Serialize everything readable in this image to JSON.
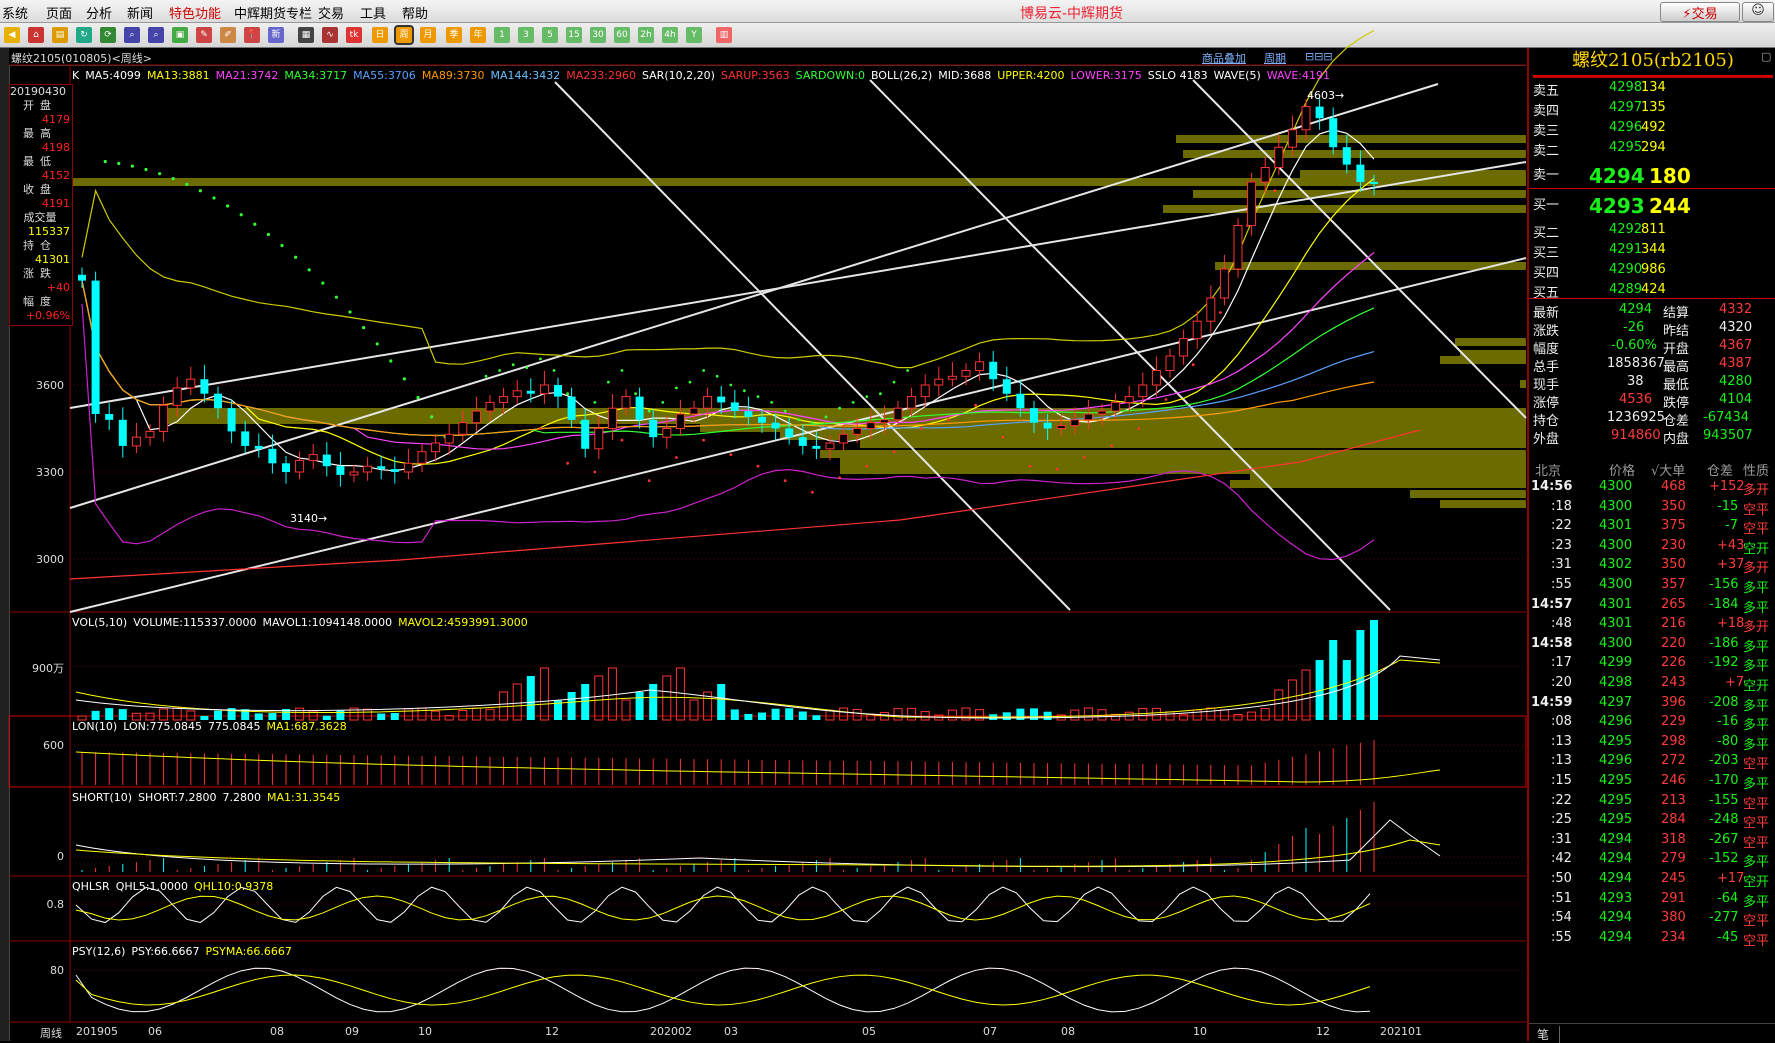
{
  "menu": [
    "系统",
    "页面",
    "分析",
    "新闻",
    "特色功能",
    "中辉期货专栏",
    "交易",
    "工具",
    "帮助"
  ],
  "app_title": "博易云-中辉期货",
  "trade_button": "交易",
  "chart_header": {
    "symbol": "螺纹2105(010805)<周线>",
    "links": [
      "商品叠加",
      "周期"
    ]
  },
  "indicators_main": [
    {
      "text": "K",
      "color": "#ffffff"
    },
    {
      "text": "MA5:4099",
      "color": "#ffffff"
    },
    {
      "text": "MA13:3881",
      "color": "#ffff00"
    },
    {
      "text": "MA21:3742",
      "color": "#ff44ff"
    },
    {
      "text": "MA34:3717",
      "color": "#33ff33"
    },
    {
      "text": "MA55:3706",
      "color": "#5aa0ff"
    },
    {
      "text": "MA89:3730",
      "color": "#ff9900"
    },
    {
      "text": "MA144:3432",
      "color": "#66c0ff"
    },
    {
      "text": "MA233:2960",
      "color": "#ff3333"
    },
    {
      "text": "SAR(10,2,20)",
      "color": "#ffffff"
    },
    {
      "text": "SARUP:3563",
      "color": "#ff3333"
    },
    {
      "text": "SARDOWN:0",
      "color": "#33ff33"
    },
    {
      "text": "BOLL(26,2)",
      "color": "#ffffff"
    },
    {
      "text": "MID:3688",
      "color": "#ffffff"
    },
    {
      "text": "UPPER:4200",
      "color": "#ffff00"
    },
    {
      "text": "LOWER:3175",
      "color": "#ff44ff"
    },
    {
      "text": "SSLO 4183",
      "color": "#ffffff"
    },
    {
      "text": "WAVE(5)",
      "color": "#ffffff"
    },
    {
      "text": "WAVE:4191",
      "color": "#ff44ff"
    }
  ],
  "info_box": [
    {
      "label": "",
      "value": "20190430"
    },
    {
      "label": "开盘",
      "value": "4179"
    },
    {
      "label": "最高",
      "value": "4198"
    },
    {
      "label": "最低",
      "value": "4152"
    },
    {
      "label": "收盘",
      "value": "4191"
    },
    {
      "label": "成交量",
      "value": "115337"
    },
    {
      "label": "持仓",
      "value": "41301"
    },
    {
      "label": "涨跌",
      "value": "+40"
    },
    {
      "label": "幅度",
      "value": "+0.96%"
    }
  ],
  "price_annotations": {
    "high": "4603→",
    "low": "3140→"
  },
  "price_axis": [
    "3600",
    "3300",
    "3000"
  ],
  "vol_indicator": [
    {
      "text": "VOL(5,10)",
      "color": "#ffffff"
    },
    {
      "text": "VOLUME:115337.0000",
      "color": "#ffffff"
    },
    {
      "text": "MAVOL1:1094148.0000",
      "color": "#ffffff"
    },
    {
      "text": "MAVOL2:4593991.3000",
      "color": "#ffff00"
    }
  ],
  "vol_axis": "900万",
  "lon_indicator": [
    {
      "text": "LON(10)",
      "color": "#ffffff"
    },
    {
      "text": "LON:775.0845",
      "color": "#ffffff"
    },
    {
      "text": "775.0845",
      "color": "#ffffff"
    },
    {
      "text": "MA1:687.3628",
      "color": "#ffff00"
    }
  ],
  "lon_axis": "600",
  "short_indicator": [
    {
      "text": "SHORT(10)",
      "color": "#ffffff"
    },
    {
      "text": "SHORT:7.2800",
      "color": "#ffffff"
    },
    {
      "text": "7.2800",
      "color": "#ffffff"
    },
    {
      "text": "MA1:31.3545",
      "color": "#ffff00"
    }
  ],
  "short_axis": "0",
  "qhl_indicator": [
    {
      "text": "QHLSR",
      "color": "#ffffff"
    },
    {
      "text": "QHL5:1.0000",
      "color": "#ffffff"
    },
    {
      "text": "QHL10:0.9378",
      "color": "#ffff00"
    }
  ],
  "qhl_axis": "0.8",
  "psy_indicator": [
    {
      "text": "PSY(12,6)",
      "color": "#ffffff"
    },
    {
      "text": "PSY:66.6667",
      "color": "#ffffff"
    },
    {
      "text": "PSYMA:66.6667",
      "color": "#ffff00"
    }
  ],
  "psy_axis": "80",
  "date_axis": {
    "label": "周线",
    "dates": [
      "201905",
      "06",
      "08",
      "09",
      "10",
      "12",
      "202002",
      "03",
      "05",
      "07",
      "08",
      "10",
      "12",
      "202101"
    ]
  },
  "right_panel": {
    "title": "螺纹2105(rb2105)",
    "asks": [
      {
        "label": "卖五",
        "price": "4298",
        "vol": "134"
      },
      {
        "label": "卖四",
        "price": "4297",
        "vol": "135"
      },
      {
        "label": "卖三",
        "price": "4296",
        "vol": "492"
      },
      {
        "label": "卖二",
        "price": "4295",
        "vol": "294"
      },
      {
        "label": "卖一",
        "price": "4294",
        "vol": "180"
      }
    ],
    "bids": [
      {
        "label": "买一",
        "price": "4293",
        "vol": "244"
      },
      {
        "label": "买二",
        "price": "4292",
        "vol": "811"
      },
      {
        "label": "买三",
        "price": "4291",
        "vol": "344"
      },
      {
        "label": "买四",
        "price": "4290",
        "vol": "986"
      },
      {
        "label": "买五",
        "price": "4289",
        "vol": "424"
      }
    ],
    "quote": [
      {
        "l1": "最新",
        "v1": "4294",
        "c1": "green",
        "l2": "结算",
        "v2": "4332",
        "c2": "red"
      },
      {
        "l1": "涨跌",
        "v1": "-26",
        "c1": "green",
        "l2": "昨结",
        "v2": "4320",
        "c2": "white"
      },
      {
        "l1": "幅度",
        "v1": "-0.60%",
        "c1": "green",
        "l2": "开盘",
        "v2": "4367",
        "c2": "red"
      },
      {
        "l1": "总手",
        "v1": "1858367",
        "c1": "white",
        "l2": "最高",
        "v2": "4387",
        "c2": "red"
      },
      {
        "l1": "现手",
        "v1": "38",
        "c1": "white",
        "l2": "最低",
        "v2": "4280",
        "c2": "green"
      },
      {
        "l1": "涨停",
        "v1": "4536",
        "c1": "red",
        "l2": "跌停",
        "v2": "4104",
        "c2": "green"
      },
      {
        "l1": "持仓",
        "v1": "1236925",
        "c1": "white",
        "l2": "仓差",
        "v2": "-67434",
        "c2": "green"
      },
      {
        "l1": "外盘",
        "v1": "914860",
        "c1": "red",
        "l2": "内盘",
        "v2": "943507",
        "c2": "green"
      }
    ],
    "tick_header": [
      "北京",
      "价格",
      "√大单",
      "仓差",
      "性质"
    ],
    "ticks": [
      {
        "t": "14:56",
        "p": "4300",
        "v": "468",
        "d": "+152",
        "n": "多开",
        "pc": "green",
        "nc": "red"
      },
      {
        "t": ":18",
        "p": "4300",
        "v": "350",
        "d": "-15",
        "n": "空平",
        "pc": "green",
        "nc": "red"
      },
      {
        "t": ":22",
        "p": "4301",
        "v": "375",
        "d": "-7",
        "n": "空平",
        "pc": "green",
        "nc": "red"
      },
      {
        "t": ":23",
        "p": "4300",
        "v": "230",
        "d": "+43",
        "n": "空开",
        "pc": "green",
        "nc": "green"
      },
      {
        "t": ":31",
        "p": "4302",
        "v": "350",
        "d": "+37",
        "n": "多开",
        "pc": "green",
        "nc": "red"
      },
      {
        "t": ":55",
        "p": "4300",
        "v": "357",
        "d": "-156",
        "n": "多平",
        "pc": "green",
        "nc": "green"
      },
      {
        "t": "14:57",
        "p": "4301",
        "v": "265",
        "d": "-184",
        "n": "多平",
        "pc": "green",
        "nc": "green"
      },
      {
        "t": ":48",
        "p": "4301",
        "v": "216",
        "d": "+18",
        "n": "多开",
        "pc": "green",
        "nc": "red"
      },
      {
        "t": "14:58",
        "p": "4300",
        "v": "220",
        "d": "-186",
        "n": "多平",
        "pc": "green",
        "nc": "green"
      },
      {
        "t": ":17",
        "p": "4299",
        "v": "226",
        "d": "-192",
        "n": "多平",
        "pc": "green",
        "nc": "green"
      },
      {
        "t": ":20",
        "p": "4298",
        "v": "243",
        "d": "+7",
        "n": "空开",
        "pc": "green",
        "nc": "green"
      },
      {
        "t": "14:59",
        "p": "4297",
        "v": "396",
        "d": "-208",
        "n": "多平",
        "pc": "green",
        "nc": "green"
      },
      {
        "t": ":08",
        "p": "4296",
        "v": "229",
        "d": "-16",
        "n": "多平",
        "pc": "green",
        "nc": "green"
      },
      {
        "t": ":13",
        "p": "4295",
        "v": "298",
        "d": "-80",
        "n": "多平",
        "pc": "green",
        "nc": "green"
      },
      {
        "t": ":13",
        "p": "4296",
        "v": "272",
        "d": "-203",
        "n": "空平",
        "pc": "green",
        "nc": "red"
      },
      {
        "t": ":15",
        "p": "4295",
        "v": "246",
        "d": "-170",
        "n": "多平",
        "pc": "green",
        "nc": "green"
      },
      {
        "t": ":22",
        "p": "4295",
        "v": "213",
        "d": "-155",
        "n": "空平",
        "pc": "green",
        "nc": "red"
      },
      {
        "t": ":25",
        "p": "4295",
        "v": "284",
        "d": "-248",
        "n": "空平",
        "pc": "green",
        "nc": "red"
      },
      {
        "t": ":31",
        "p": "4294",
        "v": "318",
        "d": "-267",
        "n": "空平",
        "pc": "green",
        "nc": "red"
      },
      {
        "t": ":42",
        "p": "4294",
        "v": "279",
        "d": "-152",
        "n": "多平",
        "pc": "green",
        "nc": "green"
      },
      {
        "t": ":50",
        "p": "4294",
        "v": "245",
        "d": "+17",
        "n": "空开",
        "pc": "green",
        "nc": "green"
      },
      {
        "t": ":51",
        "p": "4293",
        "v": "291",
        "d": "-64",
        "n": "多平",
        "pc": "green",
        "nc": "green"
      },
      {
        "t": ":54",
        "p": "4294",
        "v": "380",
        "d": "-277",
        "n": "空平",
        "pc": "green",
        "nc": "red"
      },
      {
        "t": ":55",
        "p": "4294",
        "v": "234",
        "d": "-45",
        "n": "空平",
        "pc": "green",
        "nc": "red"
      }
    ],
    "footer_tab": "笔"
  }
}
